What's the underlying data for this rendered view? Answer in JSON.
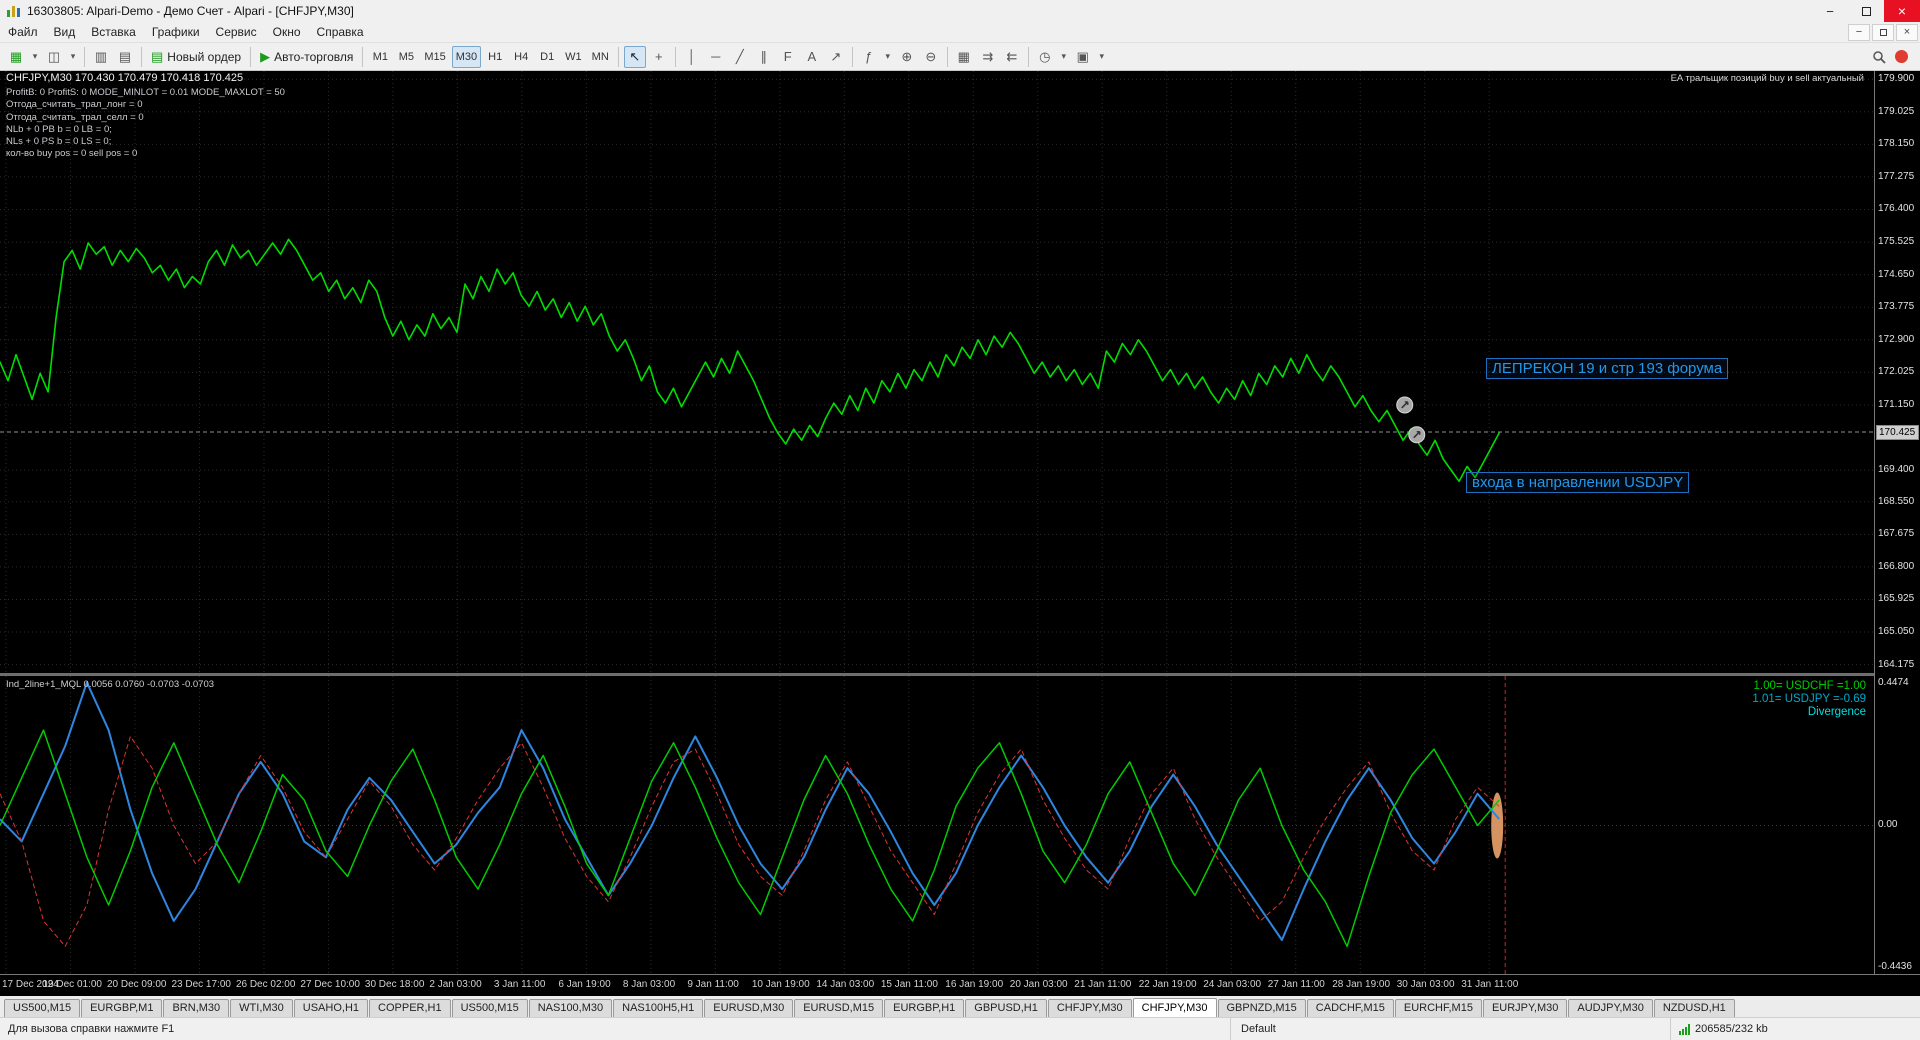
{
  "window": {
    "title": "16303805: Alpari-Demo - Демо Счет - Alpari - [CHFJPY,M30]"
  },
  "menu": {
    "items": [
      "Файл",
      "Вид",
      "Вставка",
      "Графики",
      "Сервис",
      "Окно",
      "Справка"
    ]
  },
  "toolbar": {
    "new_order_label": "Новый ордер",
    "autotrade_label": "Авто-торговля",
    "timeframes": [
      "M1",
      "M5",
      "M15",
      "M30",
      "H1",
      "H4",
      "D1",
      "W1",
      "MN"
    ],
    "active_timeframe": "M30",
    "left_icons": [
      {
        "name": "new-chart-button",
        "glyph": "▦",
        "green": true
      },
      {
        "name": "new-chart-dropdown",
        "glyph": "▾",
        "small": true
      },
      {
        "name": "profiles-button",
        "glyph": "◫"
      },
      {
        "name": "profiles-dropdown",
        "glyph": "▾",
        "small": true
      },
      {
        "sep": true
      },
      {
        "name": "market-watch-button",
        "glyph": "▥"
      },
      {
        "name": "data-window-button",
        "glyph": "▤"
      }
    ],
    "tools": [
      {
        "name": "cursor-tool",
        "glyph": "↖",
        "active": true
      },
      {
        "name": "crosshair-tool",
        "glyph": "+"
      },
      {
        "sep": true
      },
      {
        "name": "vertical-line-tool",
        "glyph": "│"
      },
      {
        "name": "horizontal-line-tool",
        "glyph": "─"
      },
      {
        "name": "trendline-tool",
        "glyph": "╱"
      },
      {
        "name": "channel-tool",
        "glyph": "∥"
      },
      {
        "name": "fibonacci-tool",
        "glyph": "F"
      },
      {
        "name": "text-tool",
        "glyph": "A"
      },
      {
        "name": "arrow-tool",
        "glyph": "↗"
      },
      {
        "sep": true
      },
      {
        "name": "indicators-button",
        "glyph": "ƒ"
      },
      {
        "name": "indicators-dropdown",
        "glyph": "▾",
        "small": true
      },
      {
        "name": "zoom-in-button",
        "glyph": "⊕"
      },
      {
        "name": "zoom-out-button",
        "glyph": "⊖"
      },
      {
        "sep": true
      },
      {
        "name": "tile-windows-button",
        "glyph": "▦"
      },
      {
        "name": "auto-scroll-button",
        "glyph": "⇉"
      },
      {
        "name": "chart-shift-button",
        "glyph": "⇇"
      },
      {
        "sep": true
      },
      {
        "name": "period-menu-button",
        "glyph": "◷"
      },
      {
        "name": "period-menu-dropdown",
        "glyph": "▾",
        "small": true
      },
      {
        "name": "templates-button",
        "glyph": "▣"
      },
      {
        "name": "templates-dropdown",
        "glyph": "▾",
        "small": true
      }
    ]
  },
  "chart": {
    "symbol_line": "CHFJPY,M30  170.430 170.479 170.418 170.425",
    "ea_lines": [
      "ProfitB: 0 ProfitS: 0 MODE_MINLOT = 0.01 MODE_MAXLOT = 50",
      "Отгода_считать_трал_лонг = 0",
      "Отгода_считать_трал_селл = 0",
      "NLb + 0 PB b = 0 LB = 0;",
      "NLs + 0 PS b = 0 LS = 0;",
      "кол-во buy pos = 0 sell pos = 0"
    ],
    "ea_note": "EA тральщик позиций buy и sell актуальный",
    "annotations": {
      "line1": "ЛЕПРЕКОН 19 и стр 193 форума",
      "line2": "входа в направлении USDJPY"
    },
    "current_price_label": "170.425"
  },
  "indicator": {
    "title": "Ind_2line+1_MQL 0.0056 0.0760 -0.0703 -0.0703",
    "labels": [
      "1.00= USDCHF =1.00",
      "1.01= USDJPY =-0.69",
      "Divergence"
    ]
  },
  "chart_data": [
    {
      "type": "line",
      "title": "CHFJPY,M30",
      "ohlc_line": "CHFJPY,M30 170.430 170.479 170.418 170.425",
      "ylim": [
        163.95,
        180.12
      ],
      "x_span_frac": 0.8,
      "ylabel_ticks": [
        "179.900",
        "179.025",
        "178.150",
        "177.275",
        "176.400",
        "175.525",
        "174.650",
        "173.775",
        "172.900",
        "172.025",
        "171.150",
        "169.400",
        "168.550",
        "167.675",
        "166.800",
        "165.925",
        "165.050",
        "164.175"
      ],
      "current_price": 170.425,
      "x_ticks": [
        "17 Dec 2024",
        "19 Dec 01:00",
        "20 Dec 09:00",
        "23 Dec 17:00",
        "26 Dec 02:00",
        "27 Dec 10:00",
        "30 Dec 18:00",
        "2 Jan 03:00",
        "3 Jan 11:00",
        "6 Jan 19:00",
        "8 Jan 03:00",
        "9 Jan 11:00",
        "10 Jan 19:00",
        "14 Jan 03:00",
        "15 Jan 11:00",
        "16 Jan 19:00",
        "20 Jan 03:00",
        "21 Jan 11:00",
        "22 Jan 19:00",
        "24 Jan 03:00",
        "27 Jan 11:00",
        "28 Jan 19:00",
        "30 Jan 03:00",
        "31 Jan 11:00"
      ],
      "markers": [
        {
          "name": "trade-marker-1",
          "t": 0.937,
          "price": 171.15
        },
        {
          "name": "trade-marker-2",
          "t": 0.945,
          "price": 170.35
        }
      ],
      "series": [
        {
          "name": "CHFJPY M30 close",
          "color": "#00dd00",
          "width": 1.6,
          "values": [
            172.3,
            171.8,
            172.5,
            171.9,
            171.3,
            172.0,
            171.5,
            173.5,
            175.0,
            175.3,
            174.8,
            175.5,
            175.2,
            175.4,
            174.9,
            175.3,
            175.0,
            175.35,
            175.1,
            174.7,
            174.9,
            174.5,
            174.8,
            174.3,
            174.6,
            174.4,
            175.0,
            175.3,
            174.9,
            175.45,
            175.1,
            175.3,
            174.9,
            175.2,
            175.5,
            175.2,
            175.6,
            175.3,
            174.9,
            174.5,
            174.7,
            174.2,
            174.5,
            174.0,
            174.3,
            173.9,
            174.5,
            174.2,
            173.5,
            173.0,
            173.4,
            172.9,
            173.3,
            173.0,
            173.6,
            173.2,
            173.5,
            173.1,
            174.4,
            174.0,
            174.6,
            174.2,
            174.8,
            174.4,
            174.7,
            174.1,
            173.8,
            174.2,
            173.7,
            174.0,
            173.5,
            173.9,
            173.4,
            173.8,
            173.3,
            173.6,
            173.0,
            172.6,
            172.9,
            172.4,
            171.8,
            172.2,
            171.5,
            171.2,
            171.6,
            171.1,
            171.5,
            171.9,
            172.3,
            171.9,
            172.4,
            172.0,
            172.6,
            172.2,
            171.8,
            171.3,
            170.8,
            170.4,
            170.1,
            170.5,
            170.2,
            170.6,
            170.3,
            170.8,
            171.2,
            170.9,
            171.4,
            171.0,
            171.6,
            171.2,
            171.8,
            171.5,
            172.0,
            171.6,
            172.1,
            171.8,
            172.3,
            171.9,
            172.5,
            172.2,
            172.7,
            172.4,
            172.9,
            172.5,
            173.0,
            172.7,
            173.1,
            172.8,
            172.4,
            172.0,
            172.3,
            171.9,
            172.2,
            171.8,
            172.1,
            171.7,
            172.0,
            171.6,
            172.6,
            172.3,
            172.8,
            172.5,
            172.9,
            172.6,
            172.2,
            171.8,
            172.1,
            171.7,
            172.0,
            171.6,
            171.9,
            171.5,
            171.2,
            171.6,
            171.3,
            171.8,
            171.4,
            172.0,
            171.7,
            172.2,
            171.9,
            172.4,
            172.0,
            172.5,
            172.1,
            171.8,
            172.2,
            171.9,
            171.5,
            171.1,
            171.4,
            171.0,
            170.7,
            171.0,
            170.6,
            170.2,
            170.5,
            170.1,
            169.8,
            170.2,
            169.7,
            169.4,
            169.1,
            169.5,
            169.2,
            169.6,
            170.0,
            170.4
          ]
        }
      ]
    },
    {
      "type": "line",
      "title": "Ind_2line+1_MQL",
      "values_line": "Ind_2line+1_MQL 0.0056 0.0760 -0.0703 -0.0703",
      "ylim": [
        -0.467,
        0.47
      ],
      "x_span_frac": 0.8,
      "y_ticks": [
        "0.4474",
        "0.00",
        "-0.4436"
      ],
      "series": [
        {
          "name": "blue-line",
          "color": "#2f86e0",
          "width": 2,
          "values": [
            0.02,
            -0.05,
            0.1,
            0.25,
            0.45,
            0.3,
            0.05,
            -0.15,
            -0.3,
            -0.2,
            -0.05,
            0.1,
            0.2,
            0.1,
            -0.05,
            -0.1,
            0.05,
            0.15,
            0.08,
            -0.02,
            -0.12,
            -0.06,
            0.04,
            0.12,
            0.3,
            0.18,
            0.02,
            -0.1,
            -0.22,
            -0.12,
            0.0,
            0.15,
            0.28,
            0.15,
            0.0,
            -0.12,
            -0.2,
            -0.1,
            0.05,
            0.18,
            0.1,
            -0.02,
            -0.15,
            -0.25,
            -0.15,
            0.0,
            0.12,
            0.22,
            0.12,
            0.0,
            -0.1,
            -0.18,
            -0.08,
            0.06,
            0.16,
            0.06,
            -0.06,
            -0.16,
            -0.26,
            -0.36,
            -0.2,
            -0.05,
            0.08,
            0.18,
            0.08,
            -0.04,
            -0.12,
            -0.02,
            0.1,
            0.02
          ]
        },
        {
          "name": "red-line",
          "color": "#dd3333",
          "width": 1,
          "dash": "5 3",
          "values": [
            0.1,
            -0.05,
            -0.3,
            -0.38,
            -0.25,
            0.05,
            0.28,
            0.18,
            0.0,
            -0.12,
            -0.05,
            0.1,
            0.22,
            0.12,
            -0.02,
            -0.1,
            0.02,
            0.14,
            0.06,
            -0.06,
            -0.14,
            -0.04,
            0.08,
            0.18,
            0.26,
            0.12,
            -0.04,
            -0.16,
            -0.24,
            -0.1,
            0.06,
            0.2,
            0.24,
            0.1,
            -0.06,
            -0.16,
            -0.22,
            -0.08,
            0.08,
            0.2,
            0.06,
            -0.08,
            -0.18,
            -0.28,
            -0.12,
            0.04,
            0.16,
            0.24,
            0.08,
            -0.04,
            -0.14,
            -0.2,
            -0.04,
            0.1,
            0.18,
            0.02,
            -0.1,
            -0.2,
            -0.3,
            -0.24,
            -0.1,
            0.02,
            0.12,
            0.2,
            0.04,
            -0.08,
            -0.14,
            0.02,
            0.12,
            0.06
          ]
        },
        {
          "name": "green-line",
          "color": "#00cc00",
          "width": 1.5,
          "values": [
            0.0,
            0.15,
            0.3,
            0.1,
            -0.1,
            -0.25,
            -0.08,
            0.12,
            0.26,
            0.1,
            -0.06,
            -0.18,
            -0.02,
            0.16,
            0.08,
            -0.08,
            -0.16,
            0.0,
            0.14,
            0.24,
            0.08,
            -0.1,
            -0.2,
            -0.06,
            0.1,
            0.22,
            0.06,
            -0.12,
            -0.22,
            -0.04,
            0.14,
            0.26,
            0.12,
            -0.04,
            -0.18,
            -0.28,
            -0.1,
            0.08,
            0.22,
            0.1,
            -0.06,
            -0.2,
            -0.3,
            -0.14,
            0.06,
            0.18,
            0.26,
            0.1,
            -0.08,
            -0.18,
            -0.06,
            0.1,
            0.2,
            0.04,
            -0.12,
            -0.22,
            -0.08,
            0.08,
            0.18,
            0.0,
            -0.14,
            -0.24,
            -0.38,
            -0.16,
            0.04,
            0.16,
            0.24,
            0.12,
            0.0,
            0.08
          ]
        }
      ]
    }
  ],
  "tabs": [
    {
      "label": "US500,M15"
    },
    {
      "label": "EURGBP,M1"
    },
    {
      "label": "BRN,M30"
    },
    {
      "label": "WTI,M30"
    },
    {
      "label": "USAHO,H1"
    },
    {
      "label": "COPPER,H1"
    },
    {
      "label": "US500,M15"
    },
    {
      "label": "NAS100,M30"
    },
    {
      "label": "NAS100H5,H1"
    },
    {
      "label": "EURUSD,M30"
    },
    {
      "label": "EURUSD,M15"
    },
    {
      "label": "EURGBP,H1"
    },
    {
      "label": "GBPUSD,H1"
    },
    {
      "label": "CHFJPY,M30"
    },
    {
      "label": "CHFJPY,M30",
      "active": true
    },
    {
      "label": "GBPNZD,M15"
    },
    {
      "label": "CADCHF,M15"
    },
    {
      "label": "EURCHF,M15"
    },
    {
      "label": "EURJPY,M30"
    },
    {
      "label": "AUDJPY,M30"
    },
    {
      "label": "NZDUSD,H1"
    }
  ],
  "status": {
    "help": "Для вызова справки нажмите F1",
    "profile": "Default",
    "traffic": "206585/232 kb"
  },
  "colors": {
    "chart_line": "#00dd00",
    "grid": "#2c2c2c",
    "annotation_blue": "#2496e8",
    "current_price_line": "#8f8f8f"
  }
}
